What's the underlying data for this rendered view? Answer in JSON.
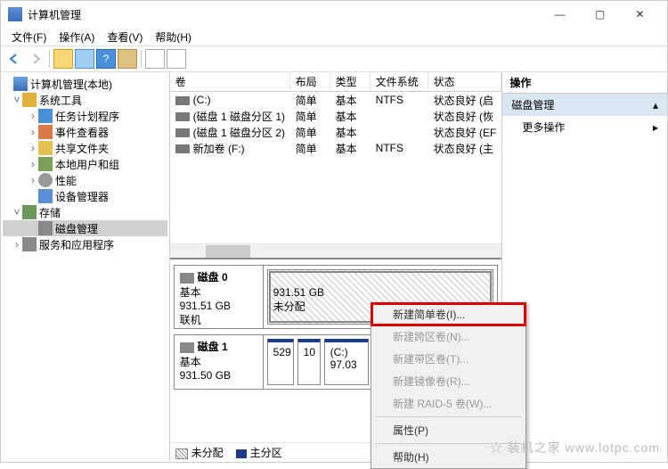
{
  "window": {
    "title": "计算机管理"
  },
  "menu": {
    "file": "文件(F)",
    "action": "操作(A)",
    "view": "查看(V)",
    "help": "帮助(H)"
  },
  "tree": {
    "root": "计算机管理(本地)",
    "sys": "系统工具",
    "task": "任务计划程序",
    "event": "事件查看器",
    "share": "共享文件夹",
    "users": "本地用户和组",
    "perf": "性能",
    "devmgr": "设备管理器",
    "storage": "存储",
    "diskmgmt": "磁盘管理",
    "services": "服务和应用程序"
  },
  "volcols": {
    "volume": "卷",
    "layout": "布局",
    "type": "类型",
    "fs": "文件系统",
    "status": "状态"
  },
  "volumes": [
    {
      "name": "(C:)",
      "layout": "简单",
      "type": "基本",
      "fs": "NTFS",
      "status": "状态良好 (启"
    },
    {
      "name": "(磁盘 1 磁盘分区 1)",
      "layout": "简单",
      "type": "基本",
      "fs": "",
      "status": "状态良好 (恢"
    },
    {
      "name": "(磁盘 1 磁盘分区 2)",
      "layout": "简单",
      "type": "基本",
      "fs": "",
      "status": "状态良好 (EF"
    },
    {
      "name": "新加卷 (F:)",
      "layout": "简单",
      "type": "基本",
      "fs": "NTFS",
      "status": "状态良好 (主"
    }
  ],
  "disks": [
    {
      "label": "磁盘 0",
      "type": "基本",
      "size": "931.51 GB",
      "state": "联机",
      "parts": [
        {
          "size": "931.51 GB",
          "status": "未分配"
        }
      ]
    },
    {
      "label": "磁盘 1",
      "type": "基本",
      "size": "931.50 GB",
      "state": "",
      "parts": [
        {
          "size": "529"
        },
        {
          "size": "10"
        },
        {
          "label": "(C:)",
          "size": "97.03"
        }
      ]
    }
  ],
  "legend": {
    "unalloc": "未分配",
    "primary": "主分区"
  },
  "actions": {
    "header": "操作",
    "diskmgmt": "磁盘管理",
    "more": "更多操作"
  },
  "context": {
    "simple": "新建简单卷(I)...",
    "spanned": "新建跨区卷(N)...",
    "striped": "新建带区卷(T)...",
    "mirror": "新建镜像卷(R)...",
    "raid5": "新建 RAID-5 卷(W)...",
    "props": "属性(P)",
    "help": "帮助(H)"
  },
  "watermark": "☆ 装机之家 www.lotpc.com"
}
